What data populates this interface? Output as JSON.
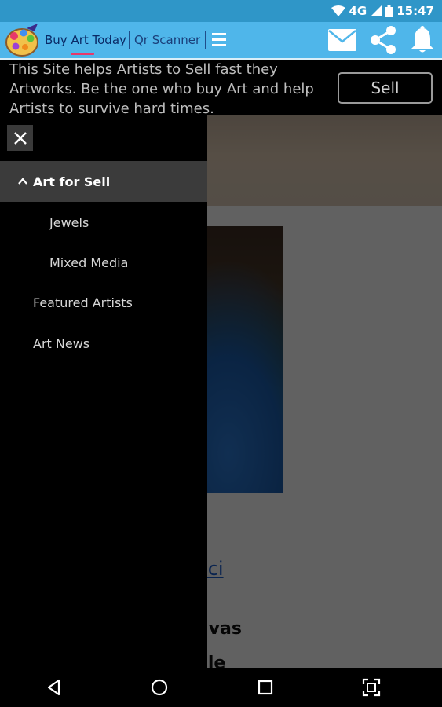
{
  "status_bar": {
    "network": "4G",
    "time": "15:47"
  },
  "app_bar": {
    "tabs": [
      {
        "label": "Buy Art Today"
      },
      {
        "label": "Qr Scanner"
      }
    ],
    "icons": [
      "menu-icon",
      "mail-icon",
      "share-icon",
      "bell-icon"
    ]
  },
  "header": {
    "tagline": "This Site helps Artists to Sell fast they Artworks. Be the one who buy Art and help Artists to survive hard times.",
    "sell_label": "Sell"
  },
  "drawer": {
    "close_icon": "close-icon",
    "items": [
      {
        "label": "Art for Sell",
        "active": true
      },
      {
        "label": "Jewels"
      },
      {
        "label": "Mixed Media"
      },
      {
        "label": "Featured Artists"
      },
      {
        "label": "Art News"
      }
    ]
  },
  "page_behind": {
    "link_text": "aci",
    "heading_1": "nvas",
    "heading_2": "ale"
  },
  "nav_bar": {
    "icons": [
      "back-icon",
      "home-icon",
      "recents-icon",
      "screenshot-icon"
    ]
  },
  "colors": {
    "status_bar": "#2f96c8",
    "app_bar": "#4fb6ea",
    "accent_underline": "#e8386a",
    "drawer_bg": "#000000",
    "drawer_active": "#3b3b3b"
  }
}
